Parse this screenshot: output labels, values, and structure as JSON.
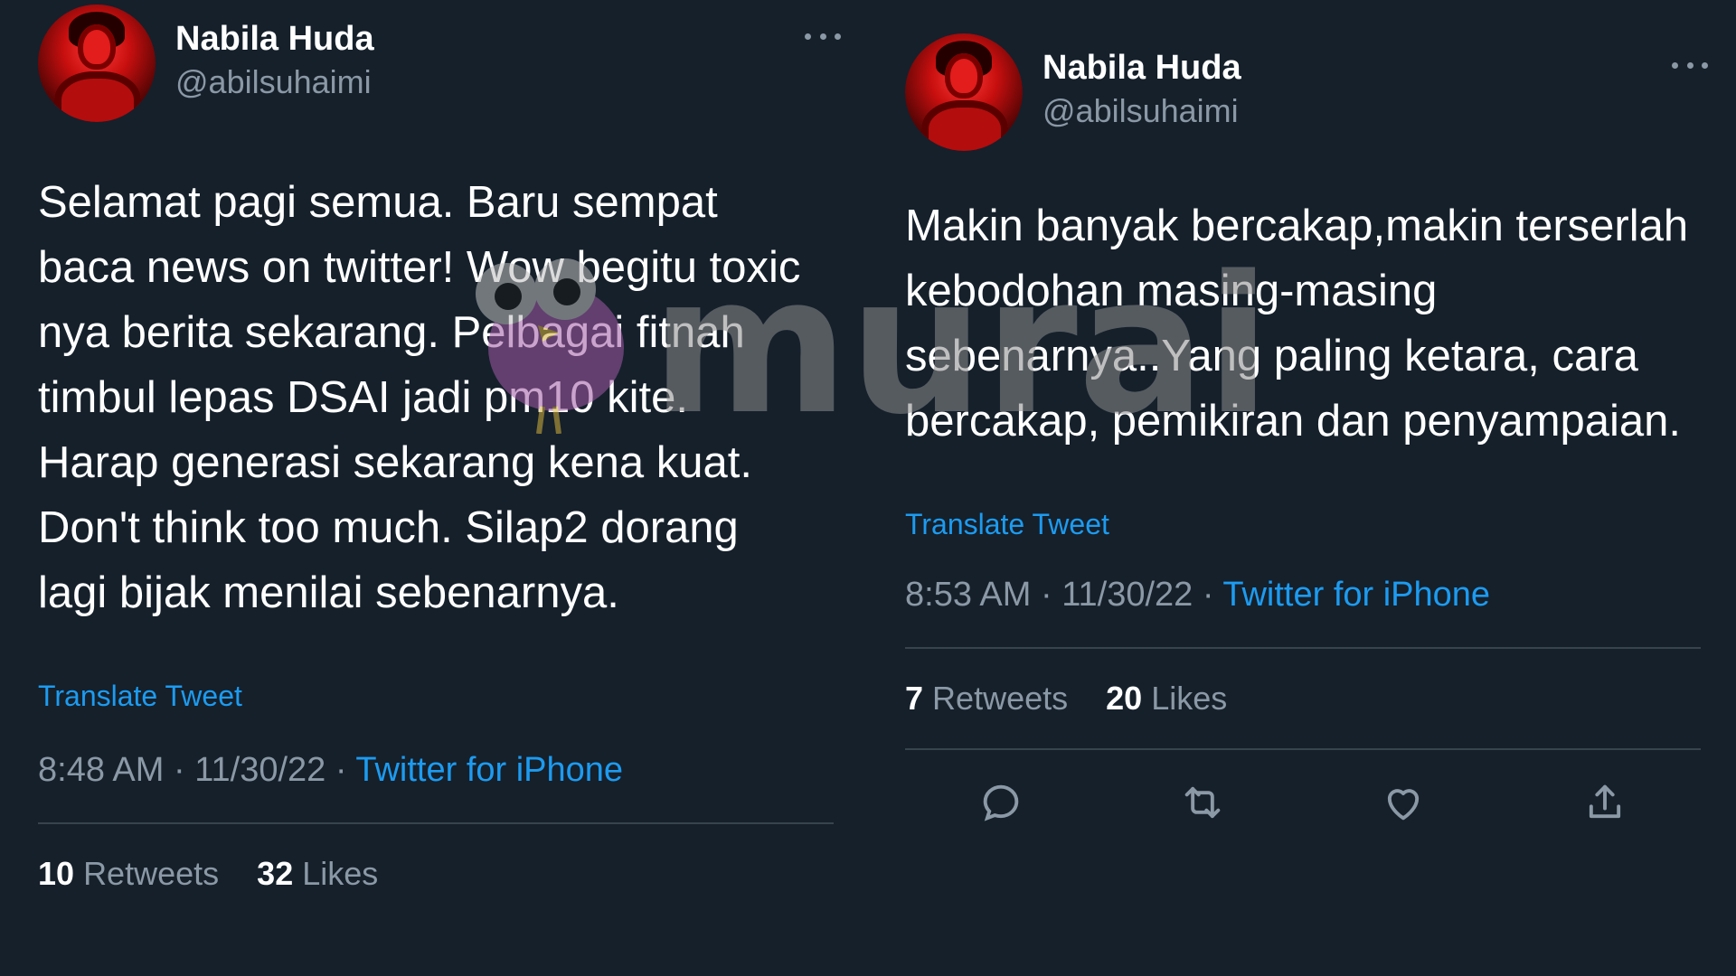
{
  "tweets": [
    {
      "name": "Nabila Huda",
      "handle": "@abilsuhaimi",
      "text": "Selamat pagi semua. Baru sempat baca news on twitter! Wow begitu toxic nya berita sekarang. Pelbagai fitnah timbul lepas DSAI jadi pm10 kite. Harap generasi sekarang kena kuat. Don't think too much. Silap2 dorang lagi bijak menilai sebenarnya.",
      "translate": "Translate Tweet",
      "time": "8:48 AM · 11/30/22 · ",
      "source": "Twitter for iPhone",
      "retweets": "10",
      "retweets_label": "Retweets",
      "likes": "32",
      "likes_label": "Likes"
    },
    {
      "name": "Nabila Huda",
      "handle": "@abilsuhaimi",
      "text": "Makin banyak bercakap,makin terserlah kebodohan masing-masing sebenarnya..Yang paling ketara, cara bercakap, pemikiran dan penyampaian.",
      "translate": "Translate Tweet",
      "time": "8:53 AM · 11/30/22 · ",
      "source": "Twitter for iPhone",
      "retweets": "7",
      "retweets_label": "Retweets",
      "likes": "20",
      "likes_label": "Likes"
    }
  ],
  "watermark": "murai",
  "icons": [
    "reply-icon",
    "retweet-icon",
    "like-icon",
    "share-icon",
    "more-icon"
  ],
  "colors": {
    "background": "#15202b",
    "text": "#ffffff",
    "muted": "#8b98a5",
    "accent": "#1d9bf0",
    "divider": "#38444d"
  }
}
